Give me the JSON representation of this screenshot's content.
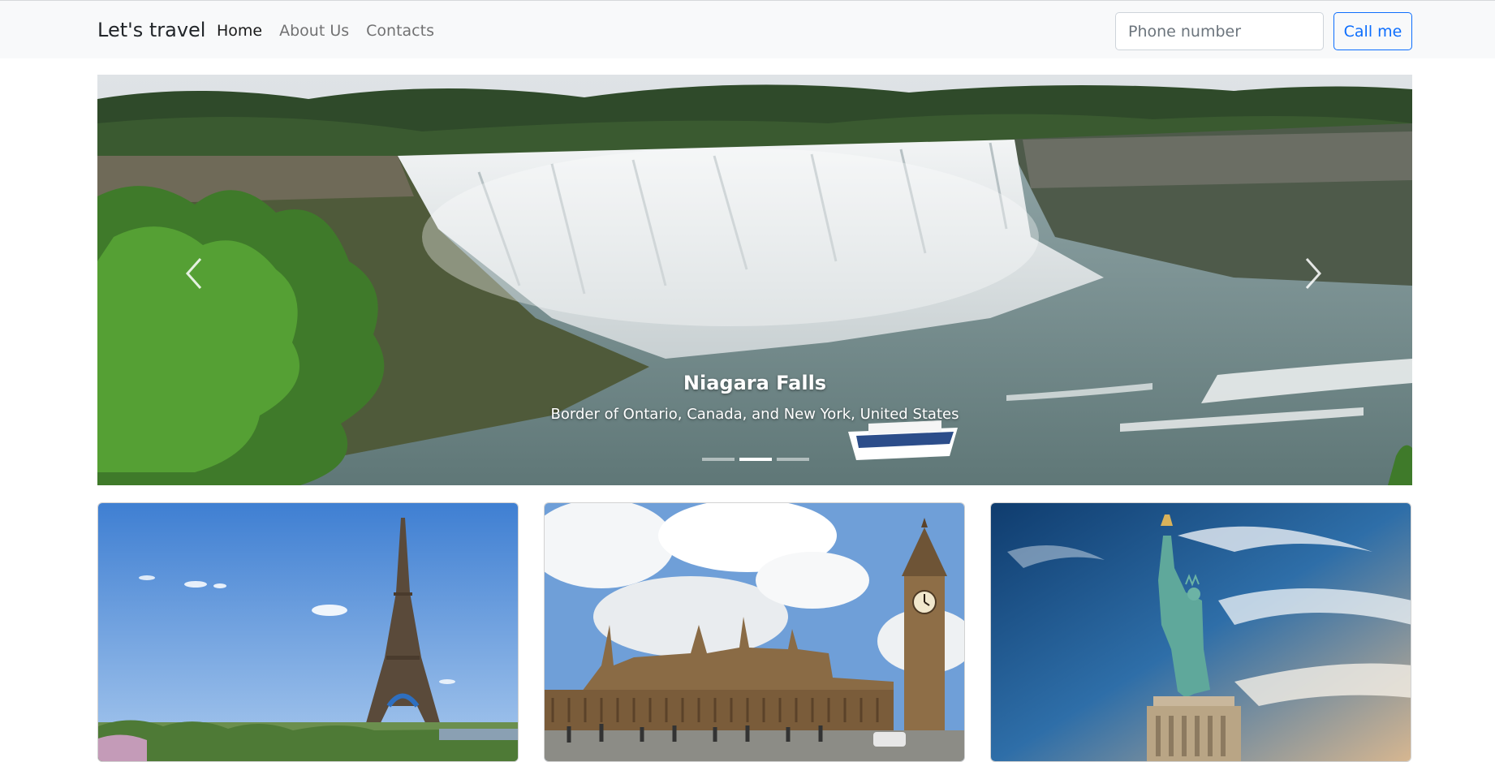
{
  "navbar": {
    "brand": "Let's travel",
    "links": [
      {
        "label": "Home",
        "active": true
      },
      {
        "label": "About Us",
        "active": false
      },
      {
        "label": "Contacts",
        "active": false
      }
    ],
    "phone_placeholder": "Phone number",
    "call_button": "Call me"
  },
  "carousel": {
    "slide_title": "Niagara Falls",
    "slide_subtitle": "Border of Ontario, Canada, and New York, United States",
    "indicator_count": 3,
    "active_indicator": 2,
    "prev_icon": "chevron-left-icon",
    "next_icon": "chevron-right-icon"
  },
  "cards": [
    {
      "image": "eiffel-tower-photo"
    },
    {
      "image": "big-ben-parliament-photo"
    },
    {
      "image": "statue-of-liberty-photo"
    }
  ],
  "colors": {
    "navbar_bg": "#f8f9fa",
    "primary": "#0d6efd"
  }
}
